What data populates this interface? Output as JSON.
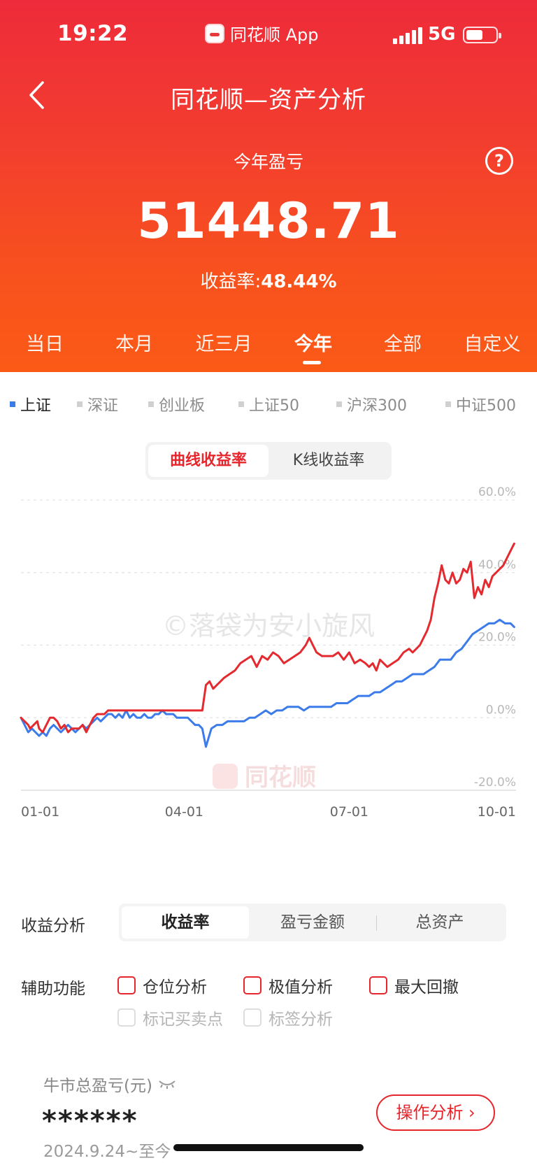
{
  "status_bar": {
    "time": "19:22",
    "app_name": "同花顺 App",
    "network": "5G"
  },
  "nav": {
    "title": "同花顺—资产分析"
  },
  "summary": {
    "label": "今年盈亏",
    "value": "51448.71",
    "rate_label": "收益率:",
    "rate_value": "48.44%"
  },
  "period_tabs": [
    "当日",
    "本月",
    "近三月",
    "今年",
    "全部",
    "自定义"
  ],
  "period_active": "今年",
  "index_tabs": [
    "上证",
    "深证",
    "创业板",
    "上证50",
    "沪深300",
    "中证500"
  ],
  "index_active": "上证",
  "chart_mode": {
    "active": "曲线收益率",
    "other": "K线收益率"
  },
  "chart_data": {
    "type": "line",
    "watermark": "©落袋为安小旋风",
    "brand_watermark": "同花顺",
    "x_ticks": [
      "01-01",
      "04-01",
      "07-01",
      "10-01"
    ],
    "y_ticks": [
      "60.0%",
      "40.0%",
      "20.0%",
      "0.0%",
      "-20.0%"
    ],
    "ylim": [
      -20,
      60
    ],
    "x_range": [
      0,
      273
    ],
    "grid": true,
    "series": [
      {
        "color": "#e42a2f",
        "x": [
          0,
          2,
          4,
          5,
          7,
          9,
          10,
          12,
          14,
          16,
          18,
          20,
          22,
          24,
          26,
          28,
          30,
          32,
          34,
          36,
          38,
          40,
          42,
          44,
          46,
          48,
          50,
          55,
          60,
          65,
          70,
          75,
          80,
          85,
          90,
          95,
          100,
          102,
          104,
          106,
          108,
          110,
          112,
          115,
          118,
          121,
          124,
          127,
          130,
          133,
          136,
          139,
          142,
          145,
          148,
          151,
          154,
          157,
          159,
          161,
          163,
          166,
          169,
          172,
          175,
          178,
          181,
          184,
          187,
          190,
          192,
          194,
          196,
          198,
          200,
          202,
          205,
          208,
          211,
          214,
          216,
          218,
          220,
          222,
          224,
          226,
          228,
          230,
          232,
          234,
          236,
          238,
          240,
          242,
          244,
          246,
          248,
          250,
          252,
          254,
          256,
          258,
          260,
          262,
          264,
          266,
          268,
          270,
          272
        ],
        "values": [
          0,
          -1,
          -2,
          -3,
          -2,
          -1,
          -3,
          -4,
          -2,
          0,
          0,
          -1,
          -3,
          -2,
          -4,
          -3,
          -3,
          -3,
          -2,
          -4,
          -2,
          0,
          1,
          1,
          1,
          2,
          2,
          2,
          2,
          2,
          2,
          2,
          2,
          2,
          2,
          2,
          2,
          9,
          10,
          8,
          9,
          10,
          11,
          12,
          13,
          15,
          16,
          17,
          14,
          17,
          16,
          18,
          17,
          15,
          16,
          17,
          18,
          20,
          22,
          20,
          18,
          17,
          17,
          17,
          18,
          16,
          18,
          15,
          16,
          15,
          14,
          15,
          13,
          16,
          15,
          14,
          15,
          16,
          18,
          19,
          18,
          19,
          20,
          22,
          24,
          27,
          33,
          37,
          42,
          38,
          37,
          40,
          37,
          38,
          41,
          40,
          43,
          33,
          36,
          34,
          38,
          36,
          39,
          40,
          41,
          42,
          44,
          46,
          48
        ]
      },
      {
        "color": "#3b7bea",
        "x": [
          0,
          2,
          4,
          6,
          8,
          10,
          12,
          14,
          16,
          18,
          20,
          22,
          24,
          26,
          28,
          30,
          32,
          34,
          36,
          38,
          40,
          42,
          44,
          46,
          48,
          50,
          52,
          54,
          56,
          58,
          60,
          62,
          64,
          66,
          68,
          70,
          72,
          74,
          76,
          78,
          80,
          82,
          84,
          86,
          88,
          90,
          92,
          94,
          96,
          98,
          100,
          102,
          105,
          108,
          111,
          114,
          117,
          120,
          123,
          126,
          129,
          132,
          135,
          138,
          141,
          144,
          147,
          150,
          153,
          156,
          159,
          162,
          165,
          168,
          171,
          174,
          177,
          180,
          183,
          186,
          189,
          192,
          195,
          198,
          201,
          204,
          207,
          210,
          213,
          216,
          219,
          222,
          225,
          228,
          231,
          234,
          237,
          240,
          243,
          246,
          249,
          252,
          255,
          258,
          261,
          264,
          267,
          270,
          272
        ],
        "values": [
          0,
          -2,
          -4,
          -3,
          -4,
          -5,
          -4,
          -5,
          -3,
          -2,
          -3,
          -4,
          -3,
          -2,
          -3,
          -4,
          -3,
          -2,
          -3,
          -2,
          -1,
          0,
          -1,
          0,
          1,
          1,
          0,
          1,
          0,
          2,
          0,
          1,
          0,
          0,
          1,
          0,
          0,
          1,
          1,
          2,
          1,
          1,
          1,
          0,
          0,
          0,
          0,
          -1,
          -2,
          -2,
          -3,
          -8,
          -3,
          -2,
          -2,
          -1,
          -1,
          -1,
          -1,
          0,
          0,
          1,
          2,
          1,
          2,
          2,
          3,
          3,
          3,
          2,
          3,
          3,
          3,
          3,
          3,
          4,
          4,
          4,
          5,
          6,
          6,
          6,
          7,
          7,
          8,
          9,
          10,
          10,
          11,
          12,
          12,
          12,
          13,
          14,
          16,
          16,
          16,
          18,
          19,
          21,
          23,
          24,
          25,
          26,
          26,
          27,
          26,
          26,
          25
        ]
      }
    ]
  },
  "analysis": {
    "label": "收益分析",
    "options": [
      "收益率",
      "盈亏金额",
      "总资产"
    ],
    "active": "收益率"
  },
  "aux": {
    "label": "辅助功能",
    "options": [
      "仓位分析",
      "极值分析",
      "最大回撤"
    ],
    "disabled": [
      "标记买卖点",
      "标签分析"
    ]
  },
  "bull": {
    "label": "牛市总盈亏(元)",
    "value": "******",
    "date": "2024.9.24~至今",
    "button": "操作分析"
  },
  "colors": {
    "primary_red": "#e6262c",
    "blue": "#3b7bea",
    "header_top": "#ee2b3a",
    "header_bottom": "#fb5a16"
  }
}
